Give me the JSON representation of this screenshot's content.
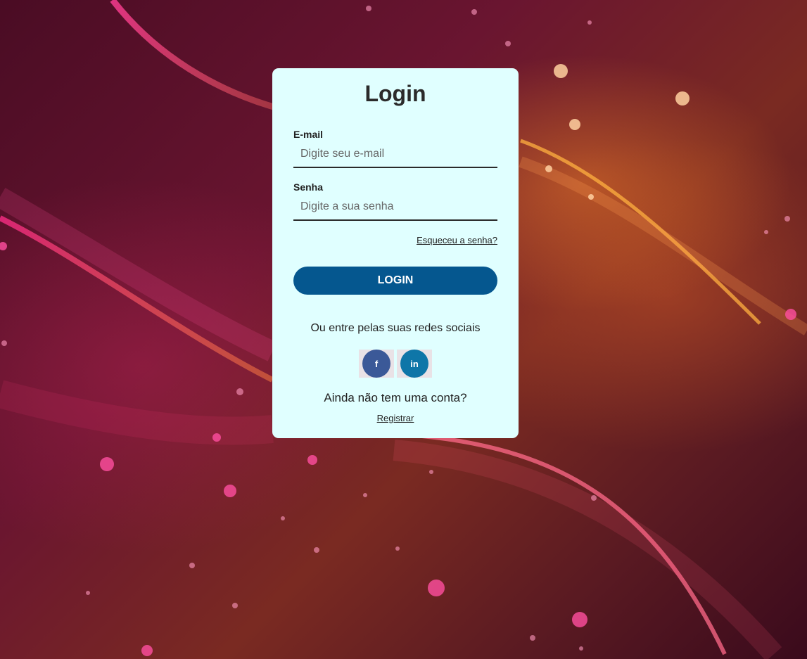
{
  "login_card": {
    "title": "Login",
    "email": {
      "label": "E-mail",
      "placeholder": "Digite seu e-mail",
      "value": ""
    },
    "password": {
      "label": "Senha",
      "placeholder": "Digite a sua senha",
      "value": ""
    },
    "forgot_password": "Esqueceu a senha?",
    "login_button": "LOGIN",
    "social_prompt": "Ou entre pelas suas redes sociais",
    "social_buttons": [
      {
        "icon": "facebook-icon",
        "glyph": "f",
        "color": "#3b5998"
      },
      {
        "icon": "linkedin-icon",
        "glyph": "in",
        "color": "#0e76a8"
      }
    ],
    "no_account": "Ainda não tem uma conta?",
    "register_link": "Registrar"
  },
  "colors": {
    "card_background": "#e0ffff",
    "primary_button": "#05578f"
  }
}
